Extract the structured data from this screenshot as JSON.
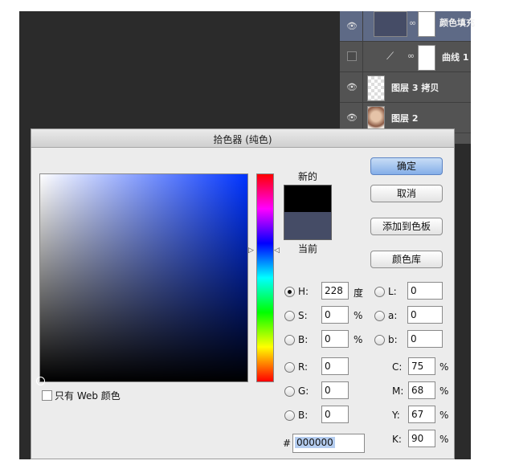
{
  "layers_panel": {
    "layers": [
      {
        "name": "颜色填充",
        "visible": true,
        "selected": true
      },
      {
        "name": "曲线 1",
        "visible": false,
        "selected": false
      },
      {
        "name": "图层 3 拷贝",
        "visible": true,
        "selected": false
      },
      {
        "name": "图层 2",
        "visible": true,
        "selected": false
      }
    ]
  },
  "dialog": {
    "title": "拾色器 (纯色)",
    "new_label": "新的",
    "current_label": "当前",
    "new_color": "#000000",
    "current_color": "#454c66",
    "buttons": {
      "ok": "确定",
      "cancel": "取消",
      "add_to_swatches": "添加到色板",
      "color_libraries": "颜色库"
    },
    "web_only_label": "只有 Web 颜色",
    "fields": {
      "H": {
        "label": "H:",
        "value": "228",
        "unit": "度",
        "selected": true
      },
      "S": {
        "label": "S:",
        "value": "0",
        "unit": "%"
      },
      "B": {
        "label": "B:",
        "value": "0",
        "unit": "%"
      },
      "R": {
        "label": "R:",
        "value": "0"
      },
      "G": {
        "label": "G:",
        "value": "0"
      },
      "B2": {
        "label": "B:",
        "value": "0"
      },
      "L": {
        "label": "L:",
        "value": "0"
      },
      "a": {
        "label": "a:",
        "value": "0"
      },
      "b": {
        "label": "b:",
        "value": "0"
      },
      "C": {
        "label": "C:",
        "value": "75",
        "unit": "%"
      },
      "M": {
        "label": "M:",
        "value": "68",
        "unit": "%"
      },
      "Y": {
        "label": "Y:",
        "value": "67",
        "unit": "%"
      },
      "K": {
        "label": "K:",
        "value": "90",
        "unit": "%"
      }
    },
    "hex_symbol": "#",
    "hex_value": "000000"
  }
}
